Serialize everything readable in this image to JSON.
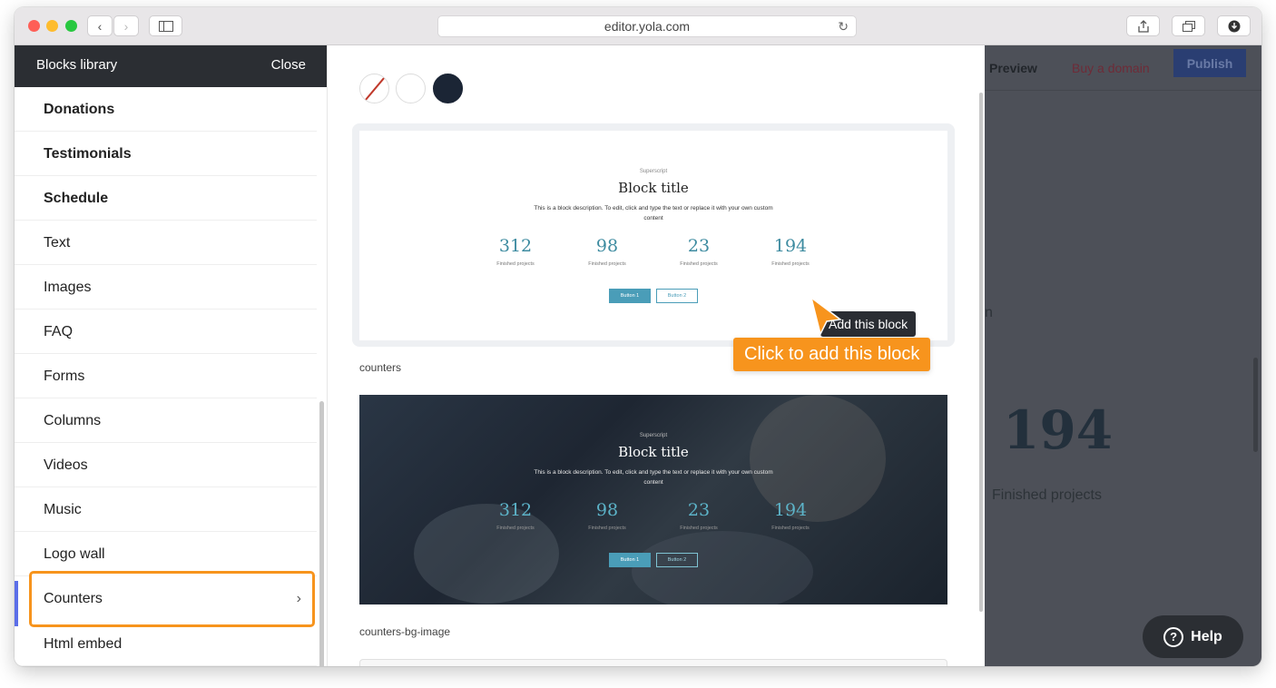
{
  "browser": {
    "url": "editor.yola.com",
    "colors": {
      "close": "#fe5f57",
      "minimize": "#febc2e",
      "zoom": "#28c840"
    }
  },
  "sidebar": {
    "title": "Blocks library",
    "close_label": "Close",
    "items": [
      {
        "label": "Donations",
        "bold": true
      },
      {
        "label": "Testimonials",
        "bold": true
      },
      {
        "label": "Schedule",
        "bold": true
      },
      {
        "label": "Text"
      },
      {
        "label": "Images"
      },
      {
        "label": "FAQ"
      },
      {
        "label": "Forms"
      },
      {
        "label": "Columns"
      },
      {
        "label": "Videos"
      },
      {
        "label": "Music"
      },
      {
        "label": "Logo wall"
      },
      {
        "label": "Counters",
        "active": true
      },
      {
        "label": "Html embed"
      }
    ],
    "chevron": "›",
    "accent": "#f7941d"
  },
  "gallery": {
    "blocks": [
      {
        "superscript": "Superscript",
        "title": "Block title",
        "description": "This is a block description. To edit, click and type the text or replace it with your own custom content",
        "counters": [
          {
            "value": "312",
            "label": "Finished projects"
          },
          {
            "value": "98",
            "label": "Finished projects"
          },
          {
            "value": "23",
            "label": "Finished projects"
          },
          {
            "value": "194",
            "label": "Finished projects"
          }
        ],
        "button1": "Button 1",
        "button2": "Button 2",
        "name": "counters"
      },
      {
        "superscript": "Superscript",
        "title": "Block title",
        "description": "This is a block description. To edit, click and type the text or replace it with your own custom content",
        "counters": [
          {
            "value": "312",
            "label": "Finished projects"
          },
          {
            "value": "98",
            "label": "Finished projects"
          },
          {
            "value": "23",
            "label": "Finished projects"
          },
          {
            "value": "194",
            "label": "Finished projects"
          }
        ],
        "button1": "Button 1",
        "button2": "Button 2",
        "name": "counters-bg-image"
      }
    ],
    "add_tooltip": "Add this block",
    "callout": "Click to add this block"
  },
  "preview": {
    "preview_label": "Preview",
    "buy_domain_label": "Buy a domain",
    "publish_label": "Publish",
    "big_number": "194",
    "big_label": "Finished projects",
    "fragment": "n",
    "help_label": "Help"
  }
}
